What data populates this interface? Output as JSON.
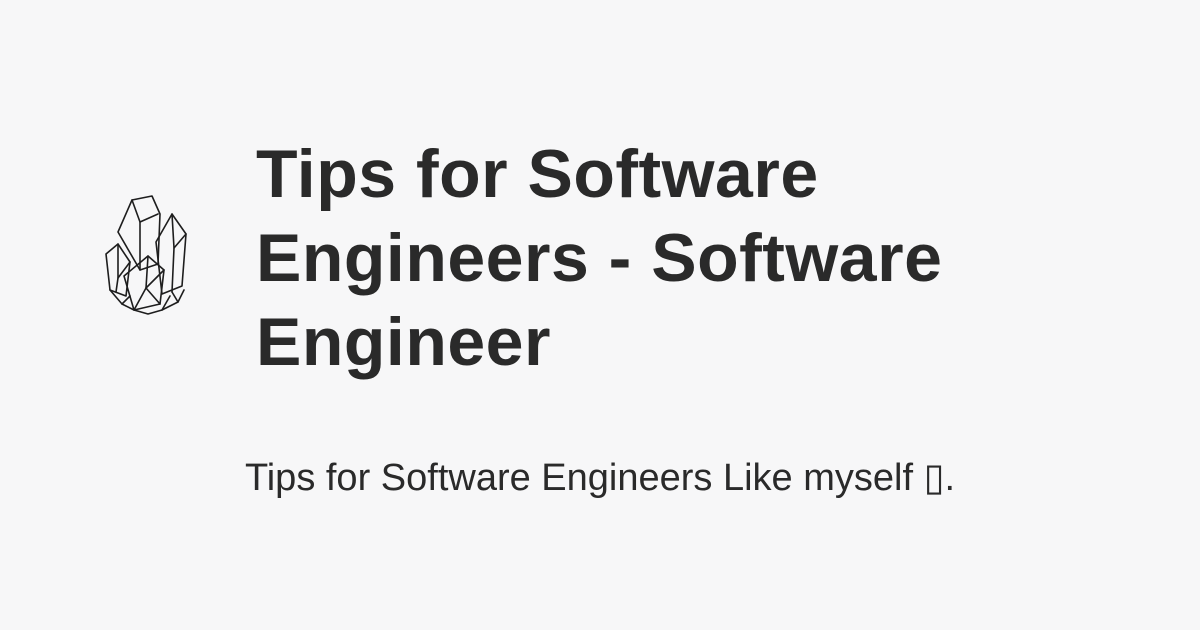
{
  "card": {
    "title": "Tips for Software Engineers - Software Engineer",
    "description": "Tips for Software Engineers Like myself ▯."
  },
  "logo": {
    "icon": "crystal-cluster-icon"
  },
  "colors": {
    "background": "#f7f7f8",
    "text": "#2a2a2a"
  }
}
